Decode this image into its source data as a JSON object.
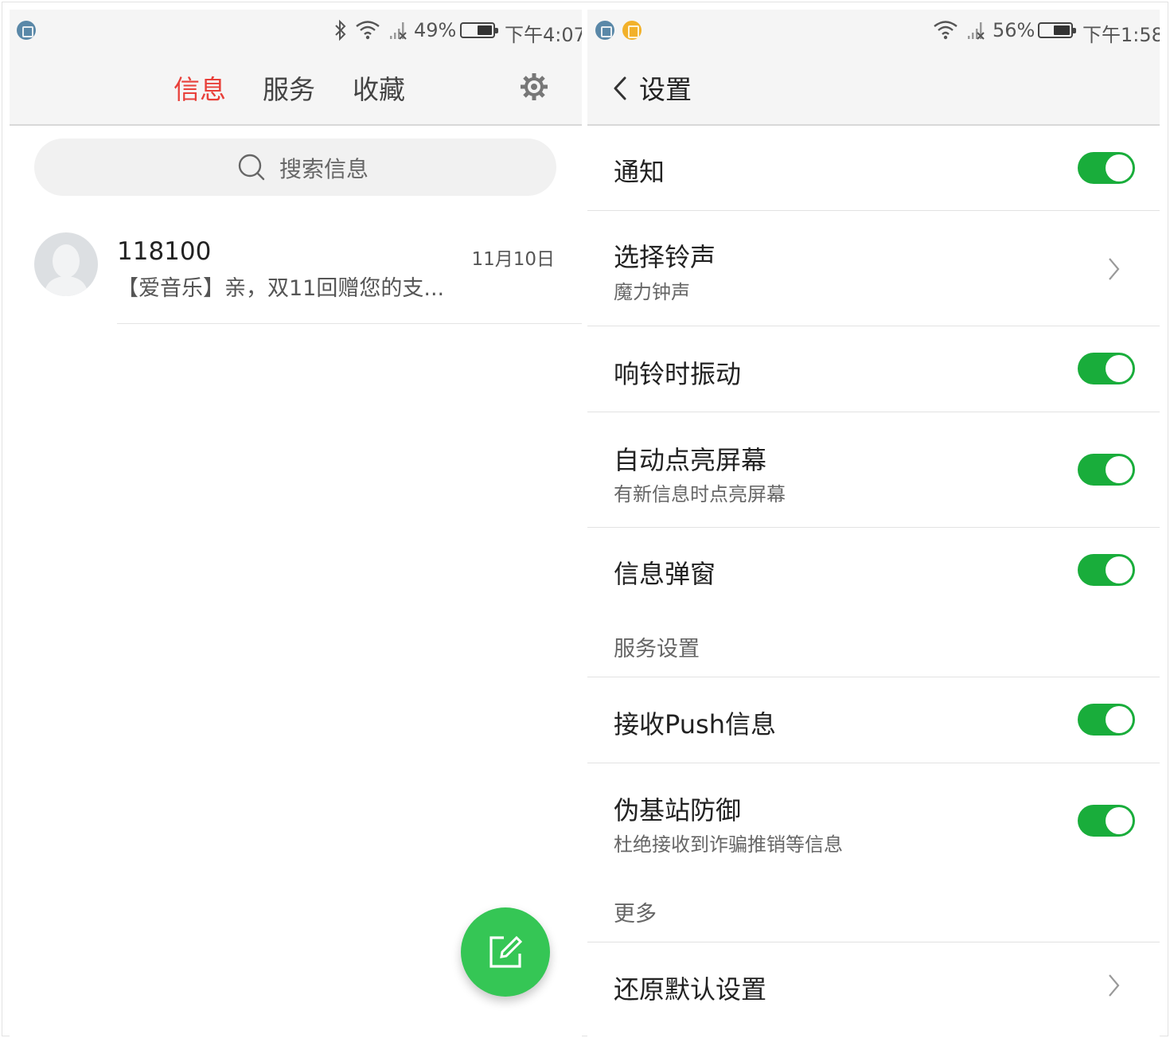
{
  "left_screen": {
    "status": {
      "battery": "49%",
      "time": "下午4:07",
      "battery_level": 0.49
    },
    "tabs": [
      {
        "label": "信息",
        "active": true
      },
      {
        "label": "服务",
        "active": false
      },
      {
        "label": "收藏",
        "active": false
      }
    ],
    "search": {
      "placeholder": "搜索信息"
    },
    "conversations": [
      {
        "sender": "118100",
        "date": "11月10日",
        "preview": "【爱音乐】亲，双11回赠您的支..."
      }
    ],
    "icons": {
      "settings": "gear-icon",
      "search": "search-icon",
      "compose": "compose-icon"
    }
  },
  "right_screen": {
    "status": {
      "battery": "56%",
      "time": "下午1:58",
      "battery_level": 0.56
    },
    "title": "设置",
    "rows": {
      "notification": {
        "title": "通知",
        "enabled": true
      },
      "ringtone": {
        "title": "选择铃声",
        "subtitle": "魔力钟声"
      },
      "vibrate": {
        "title": "响铃时振动",
        "enabled": true
      },
      "wake_screen": {
        "title": "自动点亮屏幕",
        "subtitle": "有新信息时点亮屏幕",
        "enabled": true
      },
      "popup": {
        "title": "信息弹窗",
        "enabled": true
      },
      "push": {
        "title": "接收Push信息",
        "enabled": true
      },
      "fake_station": {
        "title": "伪基站防御",
        "subtitle": "杜绝接收到诈骗推销等信息",
        "enabled": true
      },
      "restore": {
        "title": "还原默认设置"
      }
    },
    "sections": {
      "service": "服务设置",
      "more": "更多"
    }
  },
  "colors": {
    "accent_red": "#e8403a",
    "toggle_green": "#19ad3b",
    "fab_green": "#35c655",
    "bar_gray": "#f5f5f5"
  }
}
